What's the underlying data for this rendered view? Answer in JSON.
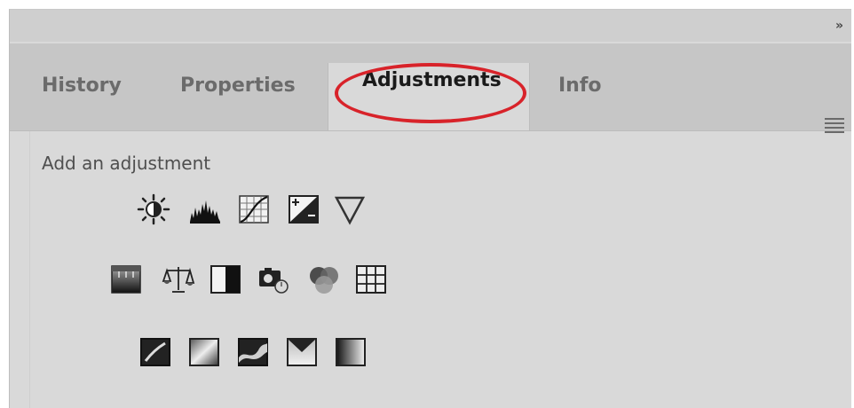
{
  "panel": {
    "collapse_glyph": "»",
    "tabs": [
      {
        "label": "History"
      },
      {
        "label": "Properties"
      },
      {
        "label": "Adjustments"
      },
      {
        "label": "Info"
      }
    ],
    "active_tab": "Adjustments",
    "highlight_color": "#d8232a"
  },
  "content": {
    "heading": "Add an adjustment"
  },
  "icons": {
    "row1": [
      "brightness-contrast-icon",
      "levels-icon",
      "curves-icon",
      "exposure-icon",
      "vibrance-icon"
    ],
    "row2": [
      "hue-saturation-icon",
      "color-balance-icon",
      "black-white-icon",
      "photo-filter-icon",
      "channel-mixer-icon",
      "color-lookup-icon"
    ],
    "row3": [
      "invert-icon",
      "posterize-icon",
      "threshold-icon",
      "selective-color-icon",
      "gradient-map-icon"
    ]
  }
}
